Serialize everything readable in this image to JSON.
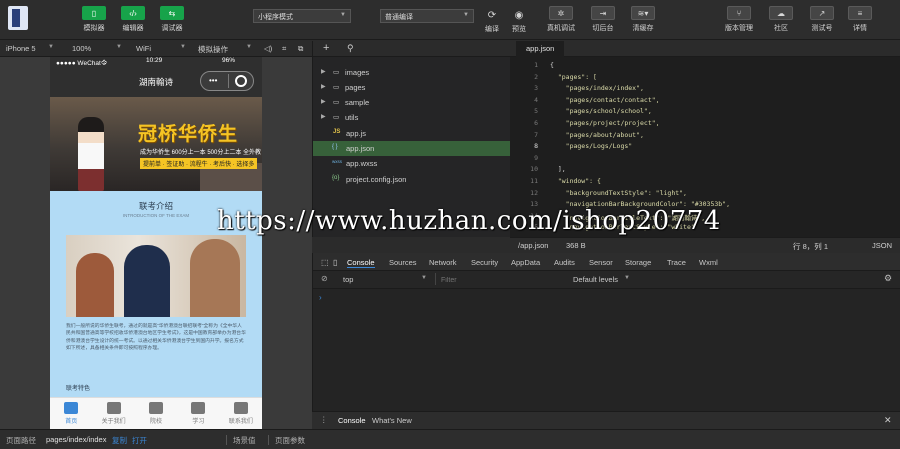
{
  "toolbar": {
    "simulator": "模拟器",
    "editor": "编辑器",
    "debugger": "调试器",
    "mode_select": "小程序模式",
    "compile_select": "普通编译",
    "compile": "编译",
    "preview": "预览",
    "real_debug": "真机调试",
    "background": "切后台",
    "clear_cache": "清缓存",
    "version": "版本管理",
    "community": "社区",
    "test_account": "测试号",
    "details": "详情"
  },
  "device_bar": {
    "device": "iPhone 5",
    "zoom": "100%",
    "network": "WiFi",
    "simulate": "模拟操作"
  },
  "phone": {
    "carrier": "●●●●● WeChat令",
    "time": "10:29",
    "battery": "96%",
    "nav_title": "湖南翰诗",
    "banner_title": "冠桥华侨生",
    "banner_sub": "成为华侨生 600分上一本 500分上二本 全外教",
    "banner_tags": "提前单 · 签证助 · 流程牛 · 考后快 · 选择多",
    "section_title": "联考介绍",
    "section_sub": "INTRODUCTION OF THE EXAM",
    "intro_text": "我们一般所说的华侨生联考，通过的就是高“华侨港澳台联招联考”全称为《全中华人民共和国普通高等学校招收华侨港澳台地区学生考试》，这是中国教育部举办为港台华侨和港澳台学生设计的统一考试。以通过相关华侨港澳台学生到国内升学。报名方式如下所述，具备相关条件即可按照程序办理。",
    "features_title": "联考特色",
    "tabs": [
      "首页",
      "关于我们",
      "院校",
      "学习",
      "联系我们"
    ]
  },
  "tree": {
    "items": [
      {
        "type": "folder",
        "name": "images"
      },
      {
        "type": "folder",
        "name": "pages"
      },
      {
        "type": "folder",
        "name": "sample"
      },
      {
        "type": "folder",
        "name": "utils"
      },
      {
        "type": "js",
        "icon": "JS",
        "name": "app.js"
      },
      {
        "type": "json",
        "icon": "{ }",
        "name": "app.json"
      },
      {
        "type": "wxss",
        "icon": "wxss",
        "name": "app.wxss"
      },
      {
        "type": "config",
        "icon": "{o}",
        "name": "project.config.json"
      }
    ]
  },
  "editor": {
    "tab": "app.json",
    "line_numbers": [
      "1",
      "2",
      "3",
      "4",
      "5",
      "6",
      "7",
      "8",
      "9",
      "10",
      "11",
      "12",
      "13",
      "14",
      "15"
    ],
    "lines": [
      "{",
      "  \"pages\": [",
      "    \"pages/index/index\",",
      "    \"pages/contact/contact\",",
      "    \"pages/school/school\",",
      "    \"pages/project/project\",",
      "    \"pages/about/about\",",
      "    \"pages/Logs/Logs\"",
      "",
      "  ],",
      "  \"window\": {",
      "    \"backgroundTextStyle\": \"light\",",
      "    \"navigationBarBackgroundColor\": \"#30353b\",",
      "    \"navigationBarTitleText\": \"湖南翰诗\",",
      "    \"navigationBarTextStyle\": \"white\""
    ]
  },
  "editor_status": {
    "path": "/app.json",
    "size": "368 B",
    "position": "行 8，列 1",
    "lang": "JSON"
  },
  "devtools": {
    "tabs": [
      "Console",
      "Sources",
      "Network",
      "Security",
      "AppData",
      "Audits",
      "Sensor",
      "Storage",
      "Trace",
      "Wxml"
    ],
    "context": "top",
    "filter_placeholder": "Filter",
    "levels": "Default levels",
    "drawer_console": "Console",
    "drawer_whatsnew": "What's New"
  },
  "statusbar": {
    "page_path_label": "页面路径",
    "page_path": "pages/index/index",
    "copy": "复制",
    "open": "打开",
    "scene": "场景值",
    "params": "页面参数"
  },
  "watermark": "https://www.huzhan.com/ishop20774"
}
